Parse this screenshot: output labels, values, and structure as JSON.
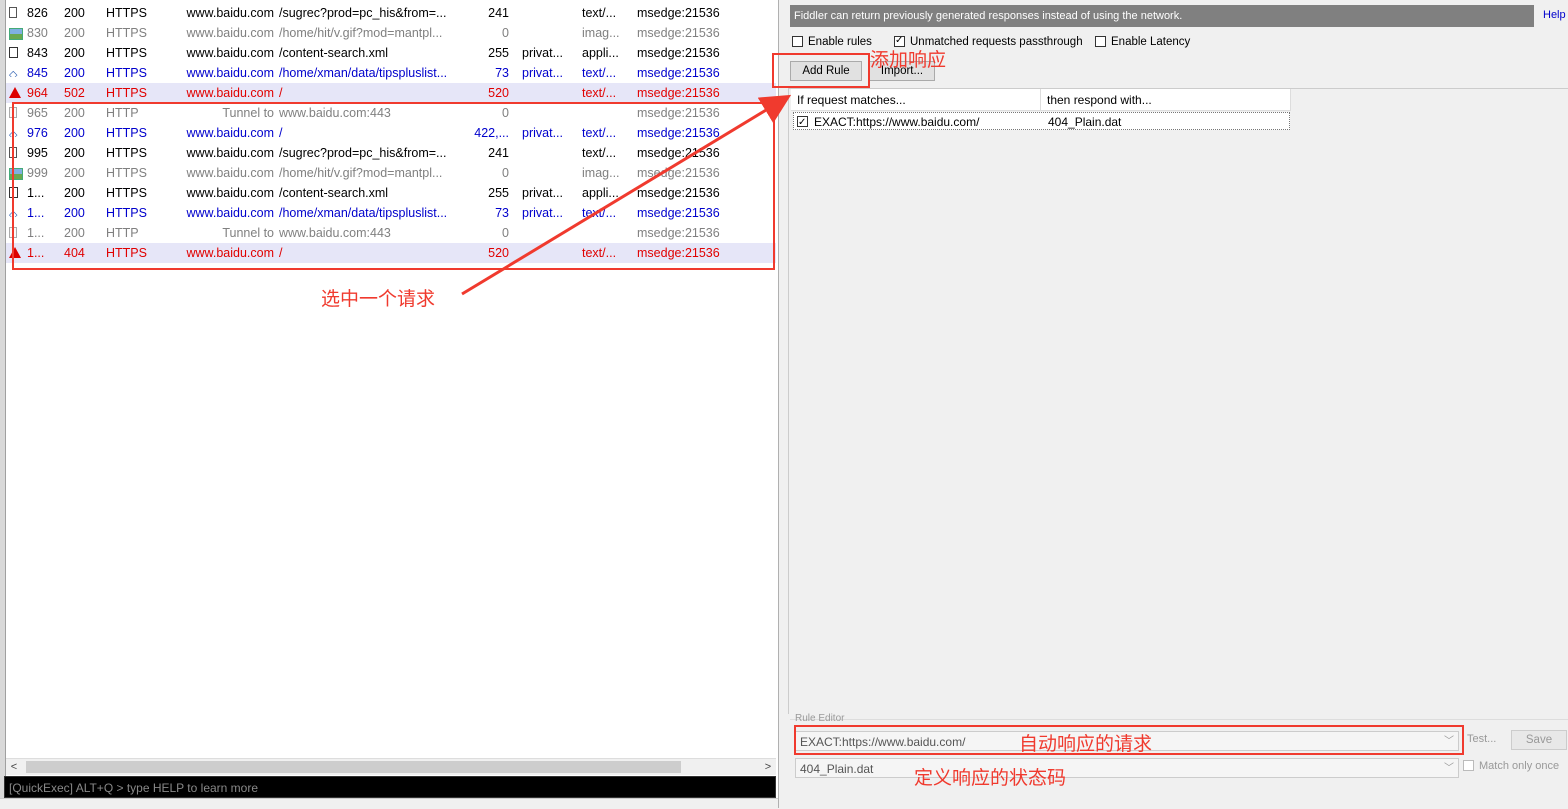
{
  "sessions": [
    {
      "icon": "doc-icon",
      "num": "826",
      "result": "200",
      "protocol": "HTTPS",
      "host": "www.baidu.com",
      "url": "/sugrec?prod=pc_his&from=...",
      "body": "241",
      "caching": "",
      "ctype": "text/...",
      "process": "msedge:21536",
      "color": "black"
    },
    {
      "icon": "image-icon",
      "num": "830",
      "result": "200",
      "protocol": "HTTPS",
      "host": "www.baidu.com",
      "url": "/home/hit/v.gif?mod=mantpl...",
      "body": "0",
      "caching": "",
      "ctype": "imag...",
      "process": "msedge:21536",
      "color": "gray"
    },
    {
      "icon": "script-icon",
      "num": "843",
      "result": "200",
      "protocol": "HTTPS",
      "host": "www.baidu.com",
      "url": "/content-search.xml",
      "body": "255",
      "caching": "privat...",
      "ctype": "appli...",
      "process": "msedge:21536",
      "color": "black"
    },
    {
      "icon": "arrows-icon",
      "num": "845",
      "result": "200",
      "protocol": "HTTPS",
      "host": "www.baidu.com",
      "url": "/home/xman/data/tipspluslist...",
      "body": "73",
      "caching": "privat...",
      "ctype": "text/...",
      "process": "msedge:21536",
      "color": "blue"
    },
    {
      "icon": "warning-icon",
      "num": "964",
      "result": "502",
      "protocol": "HTTPS",
      "host": "www.baidu.com",
      "url": "/",
      "body": "520",
      "caching": "",
      "ctype": "text/...",
      "process": "msedge:21536",
      "color": "red",
      "selected": true
    },
    {
      "icon": "tunnel-icon",
      "num": "965",
      "result": "200",
      "protocol": "HTTP",
      "host": "Tunnel to",
      "url": "www.baidu.com:443",
      "body": "0",
      "caching": "",
      "ctype": "",
      "process": "msedge:21536",
      "color": "gray"
    },
    {
      "icon": "arrows-icon",
      "num": "976",
      "result": "200",
      "protocol": "HTTPS",
      "host": "www.baidu.com",
      "url": "/",
      "body": "422,...",
      "caching": "privat...",
      "ctype": "text/...",
      "process": "msedge:21536",
      "color": "blue"
    },
    {
      "icon": "doc-icon",
      "num": "995",
      "result": "200",
      "protocol": "HTTPS",
      "host": "www.baidu.com",
      "url": "/sugrec?prod=pc_his&from=...",
      "body": "241",
      "caching": "",
      "ctype": "text/...",
      "process": "msedge:21536",
      "color": "black"
    },
    {
      "icon": "image-icon",
      "num": "999",
      "result": "200",
      "protocol": "HTTPS",
      "host": "www.baidu.com",
      "url": "/home/hit/v.gif?mod=mantpl...",
      "body": "0",
      "caching": "",
      "ctype": "imag...",
      "process": "msedge:21536",
      "color": "gray"
    },
    {
      "icon": "script-icon",
      "num": "1...",
      "result": "200",
      "protocol": "HTTPS",
      "host": "www.baidu.com",
      "url": "/content-search.xml",
      "body": "255",
      "caching": "privat...",
      "ctype": "appli...",
      "process": "msedge:21536",
      "color": "black"
    },
    {
      "icon": "arrows-icon",
      "num": "1...",
      "result": "200",
      "protocol": "HTTPS",
      "host": "www.baidu.com",
      "url": "/home/xman/data/tipspluslist...",
      "body": "73",
      "caching": "privat...",
      "ctype": "text/...",
      "process": "msedge:21536",
      "color": "blue"
    },
    {
      "icon": "tunnel-icon",
      "num": "1...",
      "result": "200",
      "protocol": "HTTP",
      "host": "Tunnel to",
      "url": "www.baidu.com:443",
      "body": "0",
      "caching": "",
      "ctype": "",
      "process": "msedge:21536",
      "color": "gray"
    },
    {
      "icon": "warning-icon",
      "num": "1...",
      "result": "404",
      "protocol": "HTTPS",
      "host": "www.baidu.com",
      "url": "/",
      "body": "520",
      "caching": "",
      "ctype": "text/...",
      "process": "msedge:21536",
      "color": "red",
      "selected": true
    }
  ],
  "quickexec": {
    "placeholder": "[QuickExec] ALT+Q > type HELP to learn more"
  },
  "autoresponder": {
    "banner": "Fiddler can return previously generated responses instead of using the network.",
    "help": "Help",
    "enable_rules": "Enable rules",
    "unmatched": "Unmatched requests passthrough",
    "latency": "Enable Latency",
    "enable_rules_checked": false,
    "unmatched_checked": true,
    "latency_checked": false,
    "add_rule": "Add Rule",
    "import": "Import...",
    "col_match": "If request matches...",
    "col_respond": "then respond with...",
    "rules": [
      {
        "checked": true,
        "match": "EXACT:https://www.baidu.com/",
        "respond": "404_Plain.dat"
      }
    ],
    "editor_label": "Rule Editor",
    "editor_match": "EXACT:https://www.baidu.com/",
    "editor_respond": "404_Plain.dat",
    "test": "Test...",
    "save": "Save",
    "match_only_once": "Match only once"
  },
  "annotations": {
    "select_request": "选中一个请求",
    "add_response": "添加响应",
    "auto_request": "自动响应的请求",
    "status_code": "定义响应的状态码"
  },
  "colors": {
    "annotation": "#f03a2e",
    "selected_row": "#e6e6f8",
    "link": "#0000cc",
    "error": "#e00000"
  }
}
